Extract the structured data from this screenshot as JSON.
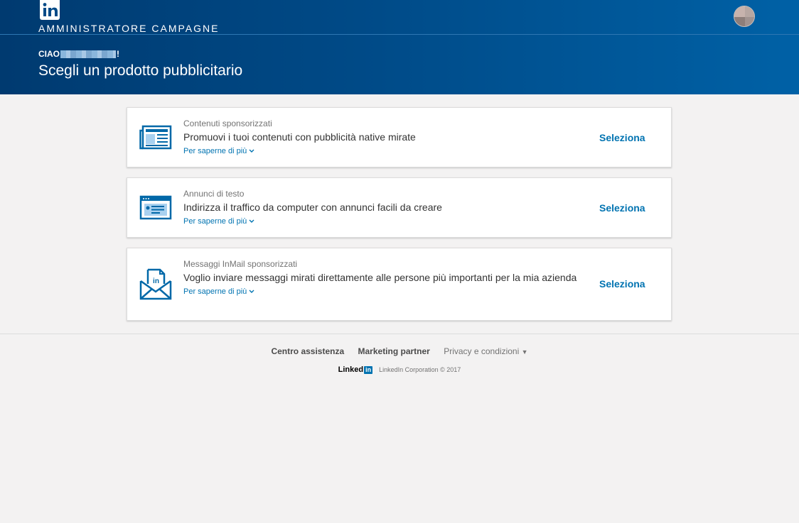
{
  "header": {
    "app_title": "AMMINISTRATORE CAMPAGNE",
    "greeting_prefix": "CIAO",
    "greeting_suffix": "!",
    "page_title": "Scegli un prodotto pubblicitario",
    "colors": {
      "gradient_start": "#003a70",
      "gradient_end": "#0061a6"
    }
  },
  "cards": [
    {
      "category": "Contenuti sponsorizzati",
      "description": "Promuovi i tuoi contenuti con pubblicità native mirate",
      "learn_more": "Per saperne di più",
      "select": "Seleziona",
      "icon": "newspaper-icon"
    },
    {
      "category": "Annunci di testo",
      "description": "Indirizza il traffico da computer con annunci facili da creare",
      "learn_more": "Per saperne di più",
      "select": "Seleziona",
      "icon": "browser-window-icon"
    },
    {
      "category": "Messaggi InMail sponsorizzati",
      "description": "Voglio inviare messaggi mirati direttamente alle persone più importanti per la mia azienda",
      "learn_more": "Per saperne di più",
      "select": "Seleziona",
      "icon": "inmail-envelope-icon"
    }
  ],
  "footer": {
    "links": [
      "Centro assistenza",
      "Marketing partner",
      "Privacy e condizioni"
    ],
    "brand_word": "Linked",
    "brand_in": "in",
    "copyright": "LinkedIn Corporation © 2017"
  },
  "accent_color": "#0073b1"
}
